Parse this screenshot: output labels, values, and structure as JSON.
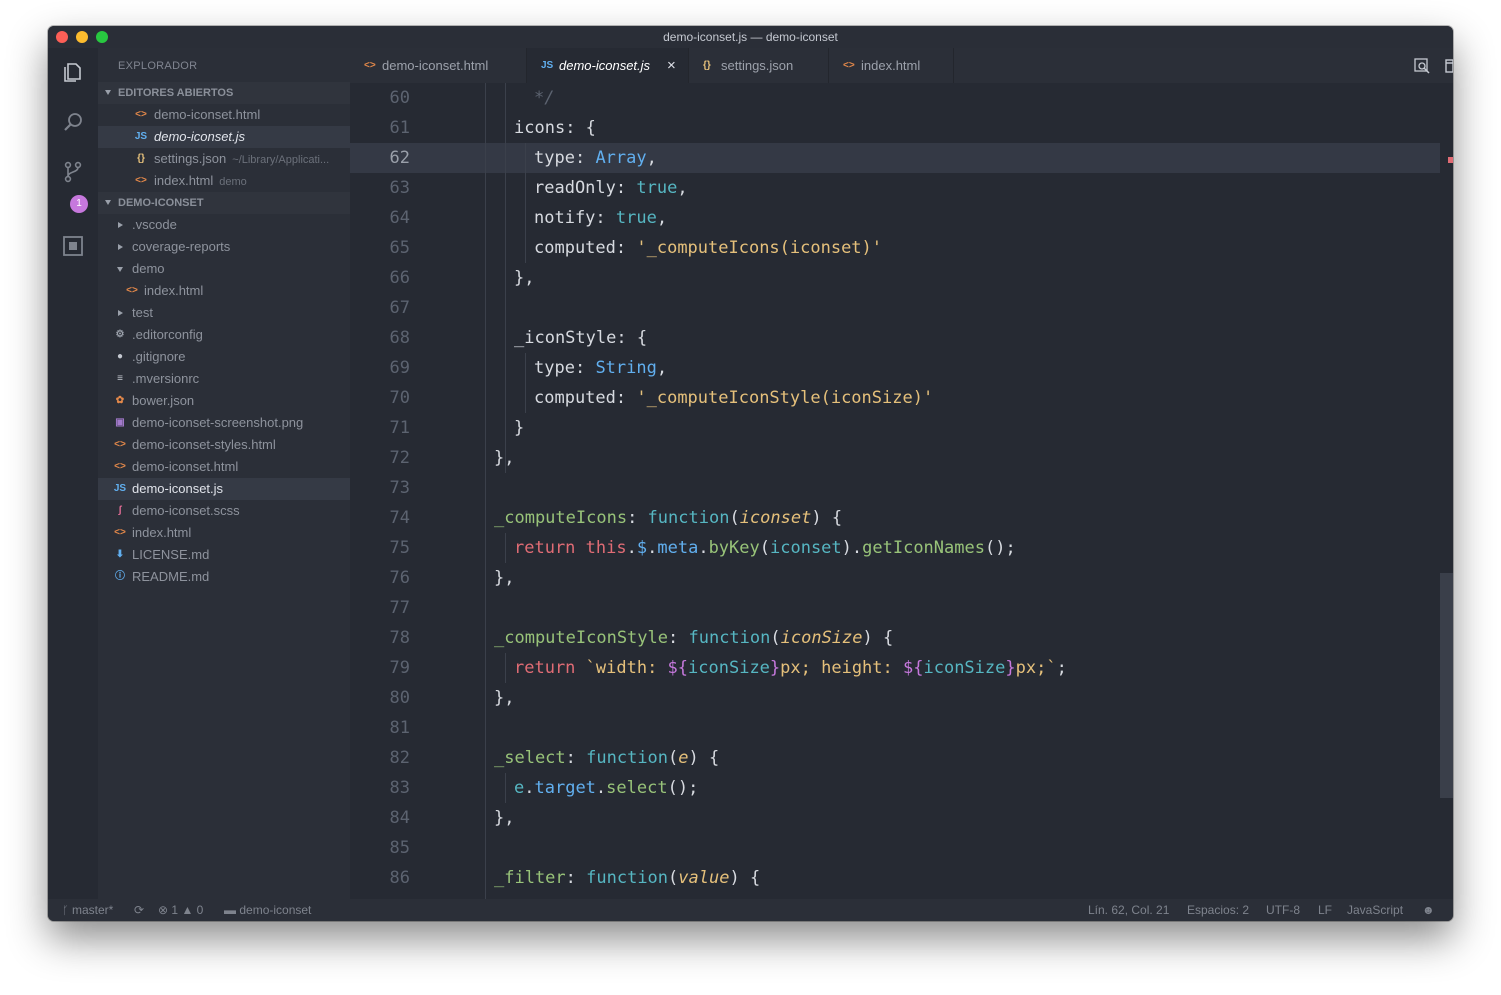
{
  "window": {
    "title": "demo-iconset.js — demo-iconset"
  },
  "sidebar": {
    "title": "EXPLORADOR",
    "open_editors_header": "EDITORES ABIERTOS",
    "open_editors": [
      {
        "label": "demo-iconset.html",
        "icon": "<>",
        "icon_color": "#e5894a"
      },
      {
        "label": "demo-iconset.js",
        "icon": "JS",
        "icon_color": "#61afef",
        "active": true
      },
      {
        "label": "settings.json",
        "icon": "{}",
        "icon_color": "#e5c07b",
        "desc": "~/Library/Applicati..."
      },
      {
        "label": "index.html",
        "icon": "<>",
        "icon_color": "#e5894a",
        "desc": "demo"
      }
    ],
    "project_header": "DEMO-ICONSET",
    "tree": [
      {
        "label": ".vscode",
        "type": "folder-collapsed"
      },
      {
        "label": "coverage-reports",
        "type": "folder-collapsed"
      },
      {
        "label": "demo",
        "type": "folder-expanded"
      },
      {
        "label": "index.html",
        "type": "file",
        "icon": "<>",
        "icon_color": "#e5894a",
        "indent": 1
      },
      {
        "label": "test",
        "type": "folder-collapsed"
      },
      {
        "label": ".editorconfig",
        "type": "file",
        "icon": "⚙",
        "icon_color": "#9aa0aa"
      },
      {
        "label": ".gitignore",
        "type": "file",
        "icon": "●",
        "icon_color": "#c5c9d1"
      },
      {
        "label": ".mversionrc",
        "type": "file",
        "icon": "≡",
        "icon_color": "#c5c9d1"
      },
      {
        "label": "bower.json",
        "type": "file",
        "icon": "✿",
        "icon_color": "#e5894a"
      },
      {
        "label": "demo-iconset-screenshot.png",
        "type": "file",
        "icon": "▣",
        "icon_color": "#a37acc"
      },
      {
        "label": "demo-iconset-styles.html",
        "type": "file",
        "icon": "<>",
        "icon_color": "#e5894a"
      },
      {
        "label": "demo-iconset.html",
        "type": "file",
        "icon": "<>",
        "icon_color": "#e5894a"
      },
      {
        "label": "demo-iconset.js",
        "type": "file",
        "icon": "JS",
        "icon_color": "#61afef",
        "active": true
      },
      {
        "label": "demo-iconset.scss",
        "type": "file",
        "icon": "ʃ",
        "icon_color": "#e06c95"
      },
      {
        "label": "index.html",
        "type": "file",
        "icon": "<>",
        "icon_color": "#e5894a"
      },
      {
        "label": "LICENSE.md",
        "type": "file",
        "icon": "⬇",
        "icon_color": "#61afef"
      },
      {
        "label": "README.md",
        "type": "file",
        "icon": "ⓘ",
        "icon_color": "#61afef"
      }
    ]
  },
  "activity": {
    "scm_badge": "1"
  },
  "tabs": [
    {
      "label": "demo-iconset.html",
      "icon": "<>",
      "icon_color": "#e5894a"
    },
    {
      "label": "demo-iconset.js",
      "icon": "JS",
      "icon_color": "#61afef",
      "active": true,
      "close": "×"
    },
    {
      "label": "settings.json",
      "icon": "{}",
      "icon_color": "#e5c07b"
    },
    {
      "label": "index.html",
      "icon": "<>",
      "icon_color": "#e5894a"
    }
  ],
  "editor": {
    "current_line": 62,
    "lines": [
      {
        "n": "60",
        "indent": 3,
        "tokens": [
          [
            "*/",
            "comment"
          ]
        ]
      },
      {
        "n": "61",
        "indent": 2,
        "tokens": [
          [
            "icons",
            "key"
          ],
          [
            ": {",
            "plain"
          ]
        ]
      },
      {
        "n": "62",
        "indent": 3,
        "tokens": [
          [
            "type",
            "key"
          ],
          [
            ": ",
            "plain"
          ],
          [
            "Array",
            "type"
          ],
          [
            ",",
            "plain"
          ]
        ]
      },
      {
        "n": "63",
        "indent": 3,
        "tokens": [
          [
            "readOnly",
            "key"
          ],
          [
            ": ",
            "plain"
          ],
          [
            "true",
            "bool"
          ],
          [
            ",",
            "plain"
          ]
        ]
      },
      {
        "n": "64",
        "indent": 3,
        "tokens": [
          [
            "notify",
            "key"
          ],
          [
            ": ",
            "plain"
          ],
          [
            "true",
            "bool"
          ],
          [
            ",",
            "plain"
          ]
        ]
      },
      {
        "n": "65",
        "indent": 3,
        "tokens": [
          [
            "computed",
            "key"
          ],
          [
            ": ",
            "plain"
          ],
          [
            "'_computeIcons(iconset)'",
            "str"
          ]
        ]
      },
      {
        "n": "66",
        "indent": 2,
        "tokens": [
          [
            "},",
            "plain"
          ]
        ]
      },
      {
        "n": "67",
        "indent": 0,
        "tokens": []
      },
      {
        "n": "68",
        "indent": 2,
        "tokens": [
          [
            "_iconStyle",
            "key"
          ],
          [
            ": {",
            "plain"
          ]
        ]
      },
      {
        "n": "69",
        "indent": 3,
        "tokens": [
          [
            "type",
            "key"
          ],
          [
            ": ",
            "plain"
          ],
          [
            "String",
            "type"
          ],
          [
            ",",
            "plain"
          ]
        ]
      },
      {
        "n": "70",
        "indent": 3,
        "tokens": [
          [
            "computed",
            "key"
          ],
          [
            ": ",
            "plain"
          ],
          [
            "'_computeIconStyle(iconSize)'",
            "str"
          ]
        ]
      },
      {
        "n": "71",
        "indent": 2,
        "tokens": [
          [
            "}",
            "plain"
          ]
        ]
      },
      {
        "n": "72",
        "indent": 1,
        "tokens": [
          [
            "},",
            "plain"
          ]
        ]
      },
      {
        "n": "73",
        "indent": 0,
        "tokens": []
      },
      {
        "n": "74",
        "indent": 1,
        "tokens": [
          [
            "_computeIcons",
            "fn"
          ],
          [
            ": ",
            "plain"
          ],
          [
            "function",
            "kw-fn"
          ],
          [
            "(",
            "plain"
          ],
          [
            "iconset",
            "param"
          ],
          [
            ") {",
            "plain"
          ]
        ]
      },
      {
        "n": "75",
        "indent": 2,
        "tokens": [
          [
            "return ",
            "ret"
          ],
          [
            "this",
            "this"
          ],
          [
            ".",
            "plain"
          ],
          [
            "$",
            "prop"
          ],
          [
            ".",
            "plain"
          ],
          [
            "meta",
            "prop"
          ],
          [
            ".",
            "plain"
          ],
          [
            "byKey",
            "method"
          ],
          [
            "(",
            "plain"
          ],
          [
            "iconset",
            "var"
          ],
          [
            ").",
            "plain"
          ],
          [
            "getIconNames",
            "method"
          ],
          [
            "();",
            "plain"
          ]
        ]
      },
      {
        "n": "76",
        "indent": 1,
        "tokens": [
          [
            "},",
            "plain"
          ]
        ]
      },
      {
        "n": "77",
        "indent": 0,
        "tokens": []
      },
      {
        "n": "78",
        "indent": 1,
        "tokens": [
          [
            "_computeIconStyle",
            "fn"
          ],
          [
            ": ",
            "plain"
          ],
          [
            "function",
            "kw-fn"
          ],
          [
            "(",
            "plain"
          ],
          [
            "iconSize",
            "param"
          ],
          [
            ") {",
            "plain"
          ]
        ]
      },
      {
        "n": "79",
        "indent": 2,
        "tokens": [
          [
            "return ",
            "ret"
          ],
          [
            "`width: ",
            "tpl"
          ],
          [
            "${",
            "interp"
          ],
          [
            "iconSize",
            "var"
          ],
          [
            "}",
            "interp"
          ],
          [
            "px; height: ",
            "tpl"
          ],
          [
            "${",
            "interp"
          ],
          [
            "iconSize",
            "var"
          ],
          [
            "}",
            "interp"
          ],
          [
            "px;`",
            "tpl"
          ],
          [
            ";",
            "plain"
          ]
        ]
      },
      {
        "n": "80",
        "indent": 1,
        "tokens": [
          [
            "},",
            "plain"
          ]
        ]
      },
      {
        "n": "81",
        "indent": 0,
        "tokens": []
      },
      {
        "n": "82",
        "indent": 1,
        "tokens": [
          [
            "_select",
            "fn"
          ],
          [
            ": ",
            "plain"
          ],
          [
            "function",
            "kw-fn"
          ],
          [
            "(",
            "plain"
          ],
          [
            "e",
            "param"
          ],
          [
            ") {",
            "plain"
          ]
        ]
      },
      {
        "n": "83",
        "indent": 2,
        "tokens": [
          [
            "e",
            "var"
          ],
          [
            ".",
            "plain"
          ],
          [
            "target",
            "prop"
          ],
          [
            ".",
            "plain"
          ],
          [
            "select",
            "method"
          ],
          [
            "();",
            "plain"
          ]
        ]
      },
      {
        "n": "84",
        "indent": 1,
        "tokens": [
          [
            "},",
            "plain"
          ]
        ]
      },
      {
        "n": "85",
        "indent": 0,
        "tokens": []
      },
      {
        "n": "86",
        "indent": 1,
        "tokens": [
          [
            "_filter",
            "fn"
          ],
          [
            ": ",
            "plain"
          ],
          [
            "function",
            "kw-fn"
          ],
          [
            "(",
            "plain"
          ],
          [
            "value",
            "param"
          ],
          [
            ") {",
            "plain"
          ]
        ]
      }
    ]
  },
  "status": {
    "branch": "master*",
    "errors": "1",
    "warnings": "0",
    "folder": "demo-iconset",
    "position": "Lín. 62, Col. 21",
    "spaces": "Espacios: 2",
    "encoding": "UTF-8",
    "eol": "LF",
    "language": "JavaScript"
  }
}
